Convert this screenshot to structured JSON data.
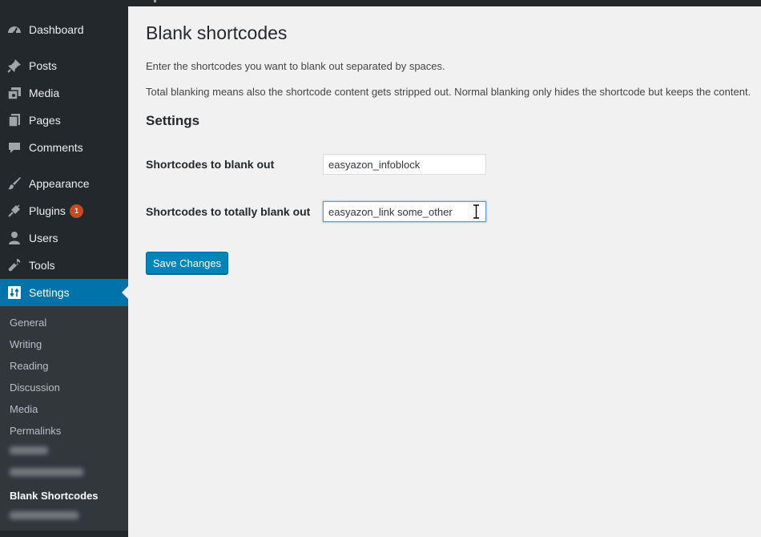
{
  "sidebar": {
    "items": [
      {
        "label": "Dashboard",
        "icon": "dashboard-icon"
      },
      {
        "label": "Posts",
        "icon": "pushpin-icon"
      },
      {
        "label": "Media",
        "icon": "media-icon"
      },
      {
        "label": "Pages",
        "icon": "pages-icon"
      },
      {
        "label": "Comments",
        "icon": "comments-icon"
      },
      {
        "label": "Appearance",
        "icon": "paintbrush-icon"
      },
      {
        "label": "Plugins",
        "icon": "plug-icon",
        "badge": "1"
      },
      {
        "label": "Users",
        "icon": "users-icon"
      },
      {
        "label": "Tools",
        "icon": "wrench-icon"
      },
      {
        "label": "Settings",
        "icon": "settings-icon",
        "current": true
      }
    ],
    "submenu": [
      {
        "label": "General"
      },
      {
        "label": "Writing"
      },
      {
        "label": "Reading"
      },
      {
        "label": "Discussion"
      },
      {
        "label": "Media"
      },
      {
        "label": "Permalinks"
      },
      {
        "label": "Blank Shortcodes",
        "current": true
      }
    ]
  },
  "page": {
    "title": "Blank shortcodes",
    "intro": "Enter the shortcodes you want to blank out separated by spaces.",
    "description": "Total blanking means also the shortcode content gets stripped out. Normal blanking only hides the shortcode but keeps the content.",
    "section_title": "Settings",
    "fields": [
      {
        "label": "Shortcodes to blank out",
        "value": "easyazon_infoblock"
      },
      {
        "label": "Shortcodes to totally blank out",
        "value": "easyazon_link some_other"
      }
    ],
    "save_label": "Save Changes"
  },
  "colors": {
    "sidebar_bg": "#23282d",
    "submenu_bg": "#32373c",
    "accent": "#0073aa",
    "button": "#0085ba",
    "badge": "#ca4a1f"
  }
}
